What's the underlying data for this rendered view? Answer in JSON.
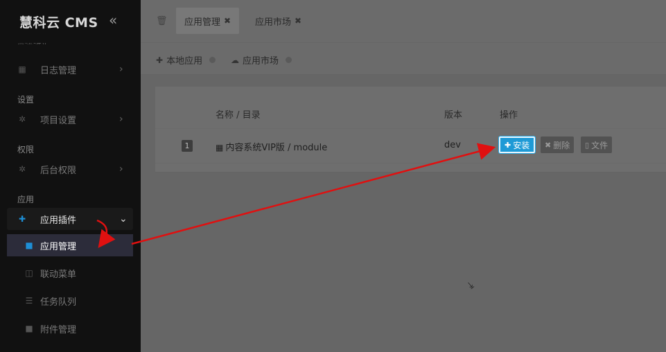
{
  "app": {
    "title": "慧科云 CMS"
  },
  "sidebar": {
    "partial_item": "系统维护",
    "items": [
      {
        "label": "日志管理",
        "icon": "calendar-icon"
      },
      {
        "section": "设置"
      },
      {
        "label": "项目设置",
        "icon": "gear-icon"
      },
      {
        "section": "权限"
      },
      {
        "label": "后台权限",
        "icon": "gear-icon"
      },
      {
        "section": "应用"
      },
      {
        "label": "应用插件",
        "icon": "puzzle-icon"
      }
    ],
    "sub_items": [
      {
        "label": "应用管理",
        "icon": "folder-icon"
      },
      {
        "label": "联动菜单",
        "icon": "columns-icon"
      },
      {
        "label": "任务队列",
        "icon": "list-indent-icon"
      },
      {
        "label": "附件管理",
        "icon": "folder-icon"
      }
    ]
  },
  "tabs": [
    {
      "label": "应用管理",
      "active": true
    },
    {
      "label": "应用市场",
      "active": false
    }
  ],
  "breadcrumb": [
    {
      "label": "本地应用",
      "icon": "puzzle-icon"
    },
    {
      "label": "应用市场",
      "icon": "cloud-icon"
    }
  ],
  "table": {
    "headers": {
      "name": "名称 / 目录",
      "version": "版本",
      "actions": "操作"
    },
    "rows": [
      {
        "index": "1",
        "name": "内容系统VIP版 / module",
        "version": "dev"
      }
    ],
    "buttons": {
      "install": "安装",
      "delete": "删除",
      "file": "文件"
    }
  },
  "colors": {
    "accent": "#1e9ad6",
    "annotation": "#e01010"
  }
}
